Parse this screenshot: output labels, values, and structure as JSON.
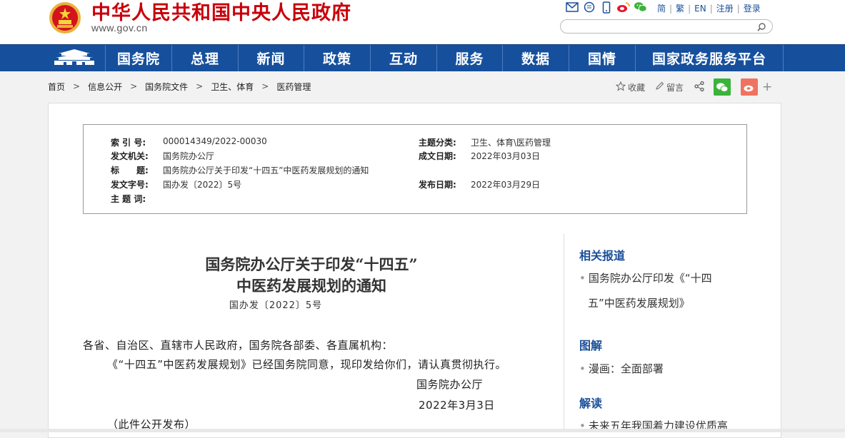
{
  "header": {
    "site_title": "中华人民共和国中央人民政府",
    "site_url": "www.gov.cn",
    "tool_icons": [
      "mail-icon",
      "message-icon",
      "mobile-icon",
      "weibo-icon",
      "wechat-icon"
    ],
    "links": [
      "简",
      "繁",
      "EN",
      "注册",
      "登录"
    ],
    "search_placeholder": ""
  },
  "nav": {
    "items": [
      "国务院",
      "总理",
      "新闻",
      "政策",
      "互动",
      "服务",
      "数据",
      "国情",
      "国家政务服务平台"
    ]
  },
  "breadcrumb": [
    "首页",
    "信息公开",
    "国务院文件",
    "卫生、体育",
    "医药管理"
  ],
  "share": {
    "favorite": "收藏",
    "comment": "留言"
  },
  "meta": {
    "index_label": "索 引 号:",
    "index_value": "000014349/2022-00030",
    "category_label": "主题分类:",
    "category_value": "卫生、体育\\医药管理",
    "issuer_label": "发文机关:",
    "issuer_value": "国务院办公厅",
    "date_made_label": "成文日期:",
    "date_made_value": "2022年03月03日",
    "title_label": "标　　题:",
    "title_value": "国务院办公厅关于印发“十四五”中医药发展规划的通知",
    "doc_no_label": "发文字号:",
    "doc_no_value": "国办发〔2022〕5号",
    "pub_date_label": "发布日期:",
    "pub_date_value": "2022年03月29日",
    "keywords_label": "主 题 词:"
  },
  "article": {
    "title_line1": "国务院办公厅关于印发“十四五”",
    "title_line2": "中医药发展规划的通知",
    "doc_no": "国办发〔2022〕5号",
    "salutation": "各省、自治区、直辖市人民政府，国务院各部委、各直属机构：",
    "body": "《“十四五”中医药发展规划》已经国务院同意，现印发给你们，请认真贯彻执行。",
    "sign_org": "国务院办公厅",
    "sign_date": "2022年3月3日",
    "note": "（此件公开发布）"
  },
  "sidebar": {
    "related_heading": "相关报道",
    "related_line1": "国务院办公厅印发《“十四",
    "related_line2": "五”中医药发展规划》",
    "graphic_heading": "图解",
    "graphic_item": "漫画：全面部署",
    "interpret_heading": "解读",
    "interpret_item": "未来五年我国着力建设优质高"
  },
  "colors": {
    "brand_red": "#c8000a",
    "nav_blue": "#16509d",
    "link_blue": "#1b4f99"
  }
}
